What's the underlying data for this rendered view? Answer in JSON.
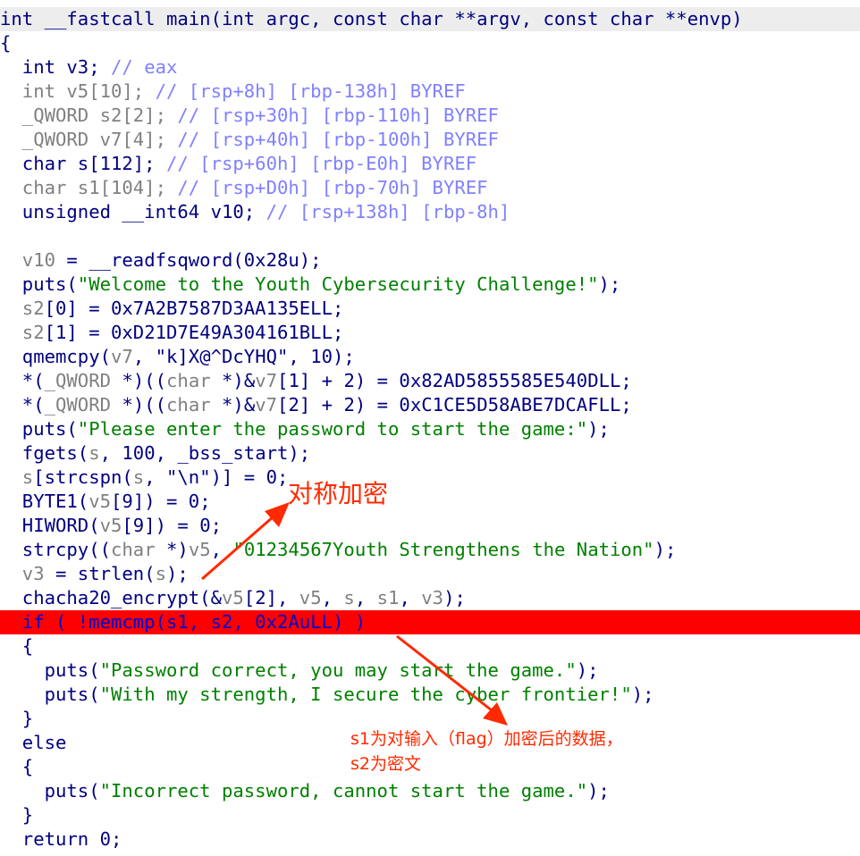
{
  "header": "int __fastcall main(int argc, const char **argv, const char **envp)",
  "lines": {
    "l01": "{",
    "l02_a": "  int v3; ",
    "l02_c": "// eax",
    "l03_a": "  int v5[10]; ",
    "l03_c": "// [rsp+8h] [rbp-138h] BYREF",
    "l04_a": "  _QWORD s2[2]; ",
    "l04_c": "// [rsp+30h] [rbp-110h] BYREF",
    "l05_a": "  _QWORD v7[4]; ",
    "l05_c": "// [rsp+40h] [rbp-100h] BYREF",
    "l06_a": "  char s[112]; ",
    "l06_c": "// [rsp+60h] [rbp-E0h] BYREF",
    "l07_a": "  char s1[104]; ",
    "l07_c": "// [rsp+D0h] [rbp-70h] BYREF",
    "l08_a": "  unsigned __int64 v10; ",
    "l08_c": "// [rsp+138h] [rbp-8h]",
    "l10_a": "  v10",
    "l10_b": " = __readfsqword(0x28u);",
    "l11_a": "  puts(",
    "l11_s": "\"Welcome to the Youth Cybersecurity Challenge!\"",
    "l11_b": ");",
    "l12_a": "  s2",
    "l12_b": "[0] = 0x7A2B7587D3AA135ELL;",
    "l13_a": "  s2",
    "l13_b": "[1] = 0xD21D7E49A304161BLL;",
    "l14_a": "  qmemcpy(",
    "l14_v": "v7",
    "l14_b": ", \"k]X@^DcYHQ\", 10);",
    "l15_a": "  *(",
    "l15_t1": "_QWORD",
    "l15_b": " *)((",
    "l15_t2": "char",
    "l15_c": " *)&",
    "l15_v": "v7",
    "l15_d": "[1] + 2) = 0x82AD5855585E540DLL;",
    "l16_a": "  *(",
    "l16_t1": "_QWORD",
    "l16_b": " *)((",
    "l16_t2": "char",
    "l16_c": " *)&",
    "l16_v": "v7",
    "l16_d": "[2] + 2) = 0xC1CE5D58ABE7DCAFLL;",
    "l17_a": "  puts(",
    "l17_s": "\"Please enter the password to start the game:\"",
    "l17_b": ");",
    "l18_a": "  fgets(",
    "l18_v": "s",
    "l18_b": ", 100, _bss_start);",
    "l19_v1": "  s",
    "l19_a": "[strcspn(",
    "l19_v2": "s",
    "l19_b": ", \"\\n\")] = 0;",
    "l20_a": "  BYTE1(",
    "l20_v": "v5",
    "l20_b": "[9]) = 0;",
    "l21_a": "  HIWORD(",
    "l21_v": "v5",
    "l21_b": "[9]) = 0;",
    "l22_a": "  strcpy((",
    "l22_t": "char",
    "l22_b": " *)",
    "l22_v": "v5",
    "l22_c": ", ",
    "l22_s": "\"01234567Youth Strengthens the Nation\"",
    "l22_d": ");",
    "l23_v": "  v3",
    "l23_a": " = strlen(",
    "l23_v2": "s",
    "l23_b": ");",
    "l24_a": "  chacha20_encrypt(&",
    "l24_v1": "v5",
    "l24_b": "[2], ",
    "l24_v2": "v5",
    "l24_c": ", ",
    "l24_v3": "s",
    "l24_d": ", ",
    "l24_v4": "s1",
    "l24_e": ", ",
    "l24_v5": "v3",
    "l24_f": ");",
    "l25": "  if ( !memcmp(s1, s2, 0x2AuLL) )",
    "l26": "  {",
    "l27_a": "    puts(",
    "l27_s": "\"Password correct, you may start the game.\"",
    "l27_b": ");",
    "l28_a": "    puts(",
    "l28_s": "\"With my strength, I secure the cyber frontier!\"",
    "l28_b": ");",
    "l29": "  }",
    "l30": "  else",
    "l31": "  {",
    "l32_a": "    puts(",
    "l32_s": "\"Incorrect password, cannot start the game.\"",
    "l32_b": ");",
    "l33": "  }",
    "l34": "  return 0;"
  },
  "annotations": {
    "symmetric": "对称加密",
    "note_line1": "s1为对输入（flag）加密后的数据，",
    "note_line2": "s2为密文"
  },
  "colors": {
    "keyword": "#000080",
    "comment": "#8080ff",
    "string": "#008000",
    "highlight": "#ff0000",
    "annotation": "#ff2a00"
  }
}
